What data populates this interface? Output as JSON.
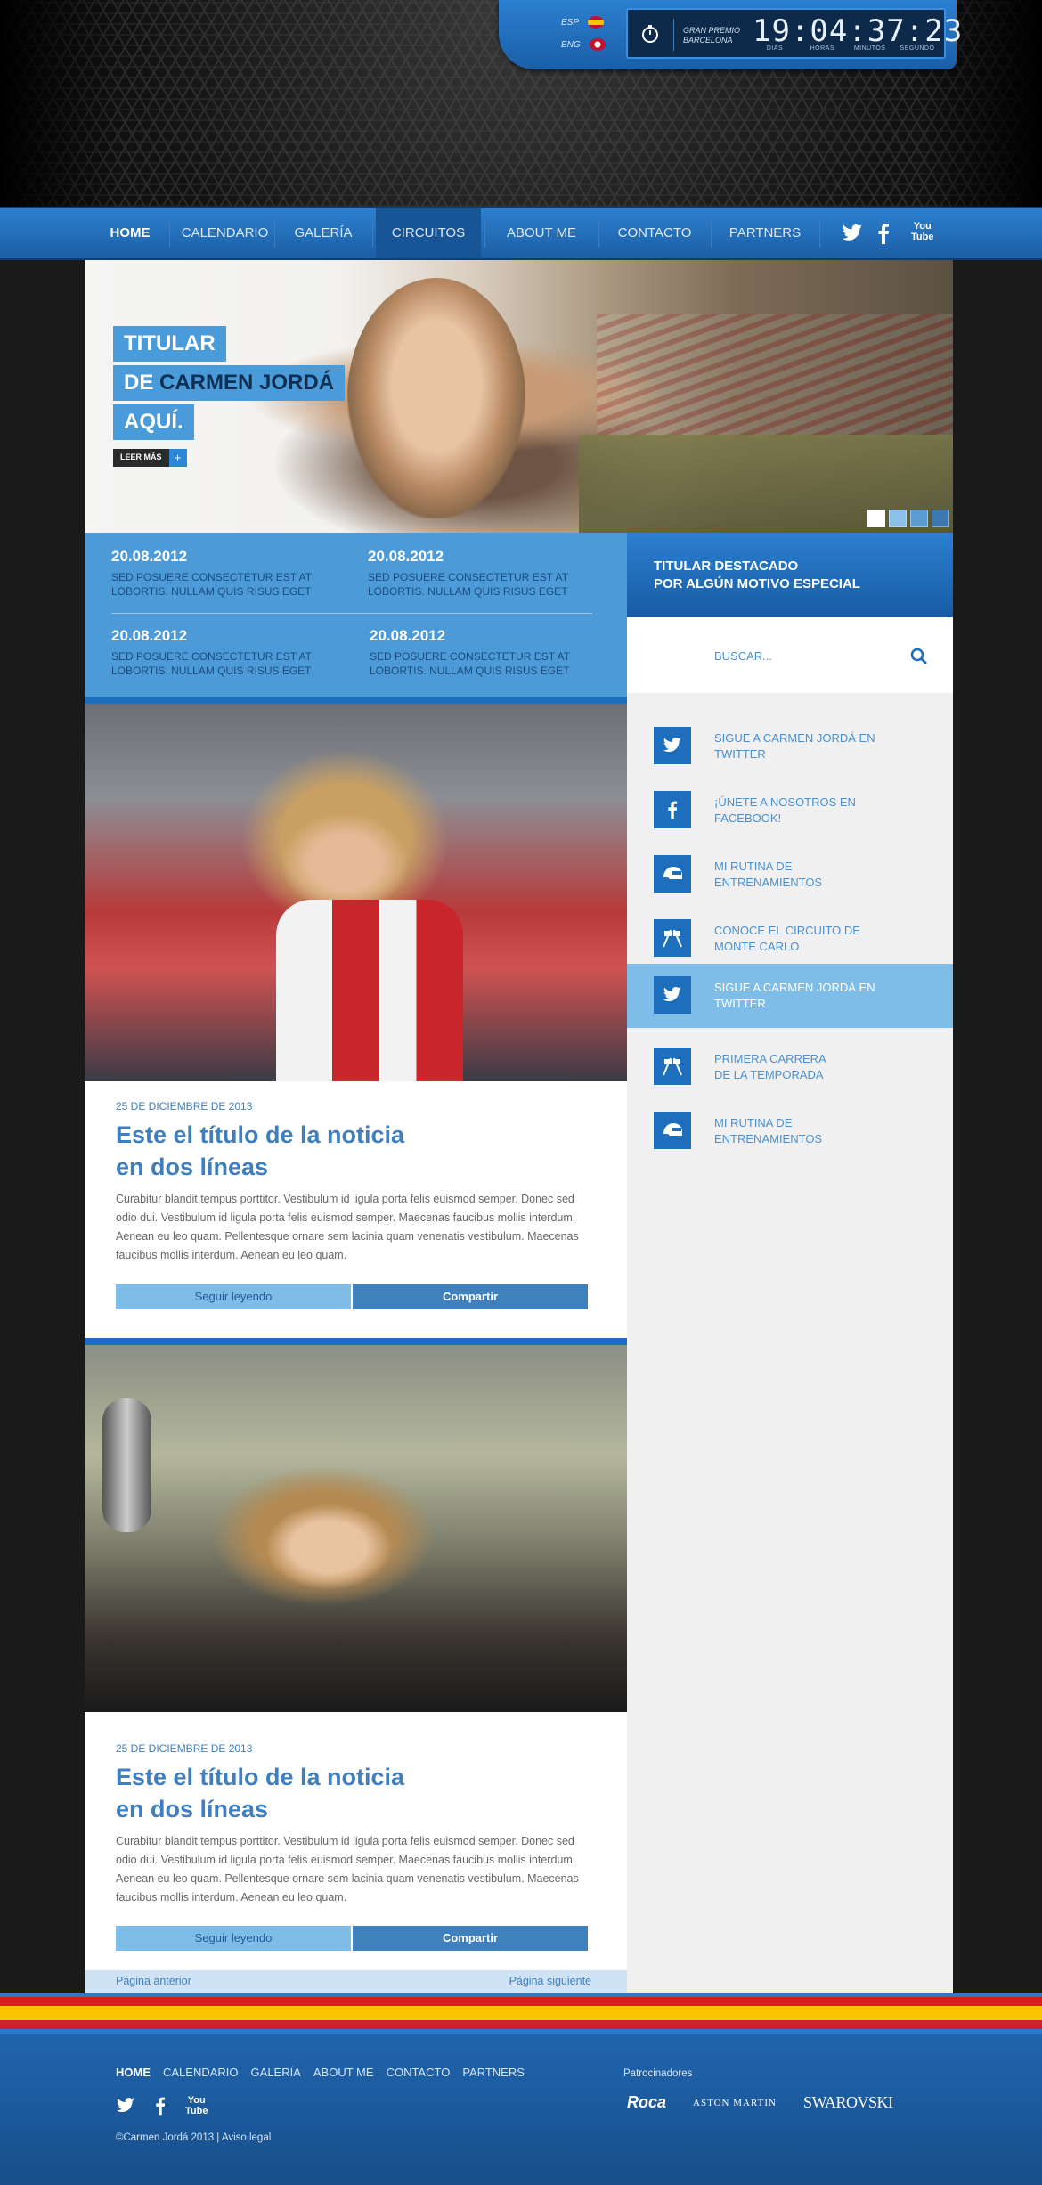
{
  "header": {
    "languages": [
      {
        "code": "ESP"
      },
      {
        "code": "ENG"
      }
    ],
    "countdown": {
      "event_line1": "GRAN PREMIO",
      "event_line2": "BARCELONA",
      "digits": "19:04:37:23",
      "labels": [
        "DIAS",
        "HORAS",
        "MINUTOS",
        "SEGUNDO"
      ]
    }
  },
  "nav": {
    "items": [
      "HOME",
      "CALENDARIO",
      "GALERÍA",
      "CIRCUITOS",
      "ABOUT ME",
      "CONTACTO",
      "PARTNERS"
    ],
    "active": "HOME",
    "highlighted": "CIRCUITOS",
    "social": [
      "twitter",
      "facebook",
      "youtube"
    ],
    "youtube_line1": "You",
    "youtube_line2": "Tube"
  },
  "hero": {
    "line1": "TITULAR",
    "line2a": "DE ",
    "line2b": "CARMEN JORDÁ",
    "line3": "AQUÍ.",
    "read_more": "LEER MÁS",
    "plus": "+",
    "slides": 4,
    "active_slide": 1
  },
  "news_strip": [
    {
      "date": "20.08.2012",
      "text": "SED POSUERE CONSECTETUR EST AT LOBORTIS. NULLAM QUIS RISUS EGET"
    },
    {
      "date": "20.08.2012",
      "text": "SED POSUERE CONSECTETUR EST AT LOBORTIS. NULLAM QUIS RISUS EGET"
    },
    {
      "date": "20.08.2012",
      "text": "SED POSUERE CONSECTETUR EST AT LOBORTIS. NULLAM QUIS RISUS EGET"
    },
    {
      "date": "20.08.2012",
      "text": "SED POSUERE CONSECTETUR EST AT LOBORTIS. NULLAM QUIS RISUS EGET"
    }
  ],
  "sidebar": {
    "heading_line1": "TITULAR DESTACADO",
    "heading_line2": "POR ALGÚN MOTIVO ESPECIAL",
    "search_placeholder": "BUSCAR...",
    "items": [
      {
        "icon": "twitter-icon",
        "line1": "SIGUE A CARMEN JORDÁ EN",
        "line2": "TWITTER",
        "selected": false
      },
      {
        "icon": "facebook-icon",
        "line1": "¡ÚNETE A NOSOTROS EN",
        "line2": "FACEBOOK!",
        "selected": false
      },
      {
        "icon": "helmet-icon",
        "line1": "MI RUTINA DE",
        "line2": "ENTRENAMIENTOS",
        "selected": false
      },
      {
        "icon": "flags-icon",
        "line1": "CONOCE EL CIRCUITO DE",
        "line2": "MONTE CARLO",
        "selected": false
      },
      {
        "icon": "twitter-icon",
        "line1": "SIGUE A CARMEN JORDÁ EN",
        "line2": "TWITTER",
        "selected": true
      },
      {
        "icon": "flags-icon",
        "line1": "PRIMERA CARRERA",
        "line2": "DE LA TEMPORADA",
        "selected": false
      },
      {
        "icon": "helmet-icon",
        "line1": "MI RUTINA DE",
        "line2": "ENTRENAMIENTOS",
        "selected": false
      }
    ]
  },
  "articles": [
    {
      "date": "25 DE DICIEMBRE DE 2013",
      "title_line1": "Este el título de la noticia",
      "title_line2": "en dos líneas",
      "body": "Curabitur blandit tempus porttitor. Vestibulum id ligula porta felis euismod semper. Donec sed odio dui. Vestibulum id ligula porta felis euismod semper. Maecenas faucibus mollis interdum. Aenean eu leo quam. Pellentesque ornare sem lacinia quam venenatis vestibulum. Maecenas faucibus mollis interdum. Aenean eu leo quam.",
      "read_label": "Seguir leyendo",
      "share_label": "Compartir"
    },
    {
      "date": "25 DE DICIEMBRE DE 2013",
      "title_line1": "Este el título de la noticia",
      "title_line2": "en dos líneas",
      "body": "Curabitur blandit tempus porttitor. Vestibulum id ligula porta felis euismod semper. Donec sed odio dui. Vestibulum id ligula porta felis euismod semper. Maecenas faucibus mollis interdum. Aenean eu leo quam. Pellentesque ornare sem lacinia quam venenatis vestibulum. Maecenas faucibus mollis interdum. Aenean eu leo quam.",
      "read_label": "Seguir leyendo",
      "share_label": "Compartir"
    }
  ],
  "pager": {
    "prev": "Página anterior",
    "next": "Página siguiente"
  },
  "footer": {
    "nav": [
      "HOME",
      "CALENDARIO",
      "GALERÍA",
      "ABOUT ME",
      "CONTACTO",
      "PARTNERS"
    ],
    "youtube_line1": "You",
    "youtube_line2": "Tube",
    "copyright": "©Carmen Jordá 2013 | Aviso legal",
    "sponsors_label": "Patrocinadores",
    "sponsors": [
      "Roca",
      "ASTON MARTIN",
      "SWAROVSKI"
    ]
  },
  "colors": {
    "brand_blue": "#1d6fbe",
    "light_blue": "#4d9ad8",
    "accent_pale": "#7fbde9",
    "spain_red": "#d32027",
    "spain_yellow": "#f8c400"
  }
}
